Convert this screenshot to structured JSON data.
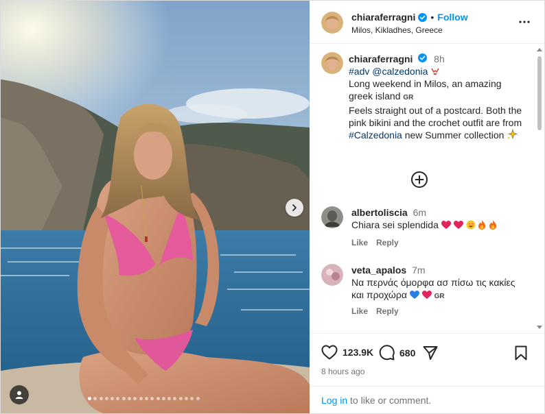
{
  "post": {
    "username": "chiaraferragni",
    "follow_label": "Follow",
    "separator": "•",
    "location": "Milos, Kikladhes, Greece"
  },
  "caption": {
    "username": "chiaraferragni",
    "time": "8h",
    "line1_tags": "#adv @calzedonia",
    "line2": "Long weekend in Milos, an amazing greek island",
    "flag": "GR",
    "line3_pre": "Feels straight out of a postcard. Both the pink bikini and the crochet outfit are from ",
    "line3_tag": "#Calzedonia",
    "line3_post": " new Summer collection"
  },
  "comments": [
    {
      "username": "albertoliscia",
      "time": "6m",
      "text": "Chiara sei splendida",
      "like_label": "Like",
      "reply_label": "Reply"
    },
    {
      "username": "veta_apalos",
      "time": "7m",
      "text": "Να περνάς όμορφα ασ πίσω τις κακίες και προχώρα",
      "flag": "GR",
      "like_label": "Like",
      "reply_label": "Reply"
    }
  ],
  "stats": {
    "likes": "123.9K",
    "comments": "680",
    "posted_ago": "8 hours ago"
  },
  "login": {
    "link": "Log in",
    "rest": " to like or comment."
  },
  "carousel": {
    "total_slides": 20,
    "active_slide": 1
  },
  "colors": {
    "accent_blue": "#0095f6",
    "link_dark_blue": "#00376b",
    "muted_text": "#737373",
    "bikini_pink": "#e45a9b"
  },
  "icons": [
    "verified-icon",
    "more-options-icon",
    "add-circle-icon",
    "heart-icon",
    "comment-icon",
    "share-icon",
    "bookmark-icon",
    "chevron-right-icon",
    "user-tag-icon"
  ]
}
